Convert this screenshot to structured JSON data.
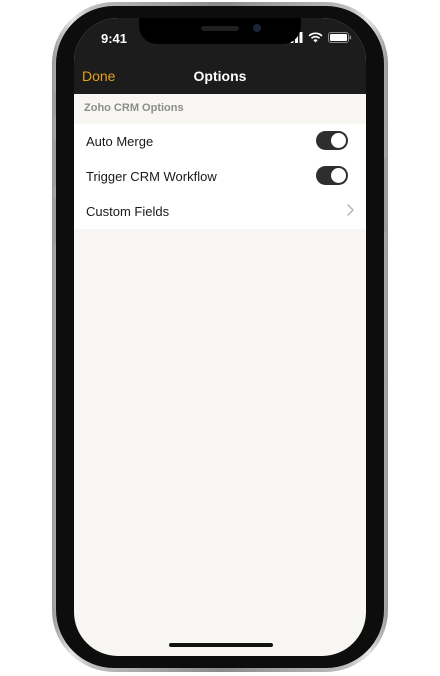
{
  "status_bar": {
    "time": "9:41"
  },
  "nav": {
    "done_label": "Done",
    "title": "Options"
  },
  "section": {
    "header": "Zoho CRM Options"
  },
  "rows": [
    {
      "label": "Auto Merge",
      "control": "toggle",
      "on": true
    },
    {
      "label": "Trigger CRM Workflow",
      "control": "toggle",
      "on": true
    },
    {
      "label": "Custom Fields",
      "control": "chevron"
    }
  ],
  "colors": {
    "accent": "#e7a21a",
    "header_bg": "#1c1c1c",
    "screen_bg": "#f8f6f2",
    "toggle_on": "#2e2e2e"
  },
  "icons": {
    "signal": "cellular-signal-icon",
    "wifi": "wifi-icon",
    "battery": "battery-icon",
    "disclosure": "chevron-right-icon"
  }
}
